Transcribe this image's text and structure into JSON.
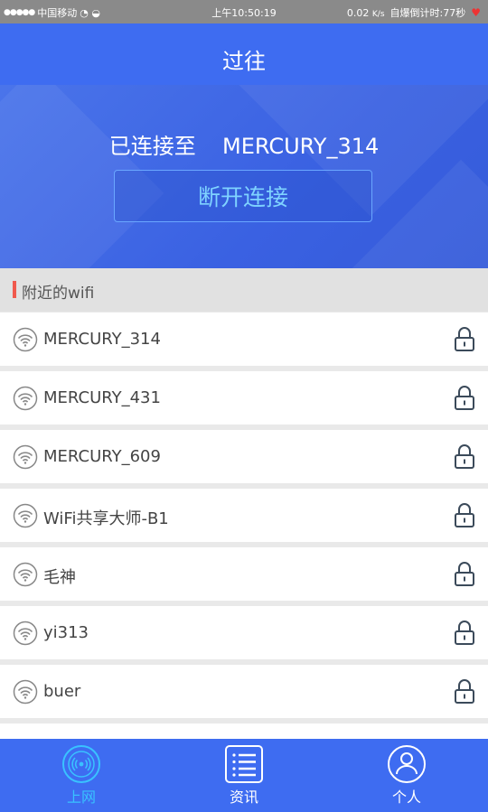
{
  "status_bar": {
    "carrier": "中国移动",
    "time": "上午10:50:19",
    "speed": "0.02",
    "speed_unit": "K/s",
    "countdown": "自爆倒计时:77秒"
  },
  "header": {
    "title": "过往"
  },
  "connection": {
    "connected_prefix": "已连接至",
    "ssid": "MERCURY_314",
    "disconnect_label": "断开连接"
  },
  "nearby": {
    "title": "附近的wifi"
  },
  "wifi_list": [
    {
      "ssid": "MERCURY_314"
    },
    {
      "ssid": "MERCURY_431"
    },
    {
      "ssid": "MERCURY_609"
    },
    {
      "ssid": "WiFi共享大师-B1"
    },
    {
      "ssid": "毛神"
    },
    {
      "ssid": "yi313"
    },
    {
      "ssid": "buer"
    }
  ],
  "tabs": [
    {
      "label": "上网",
      "icon": "wifi-signal-icon",
      "active": true
    },
    {
      "label": "资讯",
      "icon": "list-icon",
      "active": false
    },
    {
      "label": "个人",
      "icon": "person-icon",
      "active": false
    }
  ],
  "colors": {
    "primary": "#3e6cf1",
    "accent": "#39c2ff",
    "marker": "#f0594d"
  }
}
